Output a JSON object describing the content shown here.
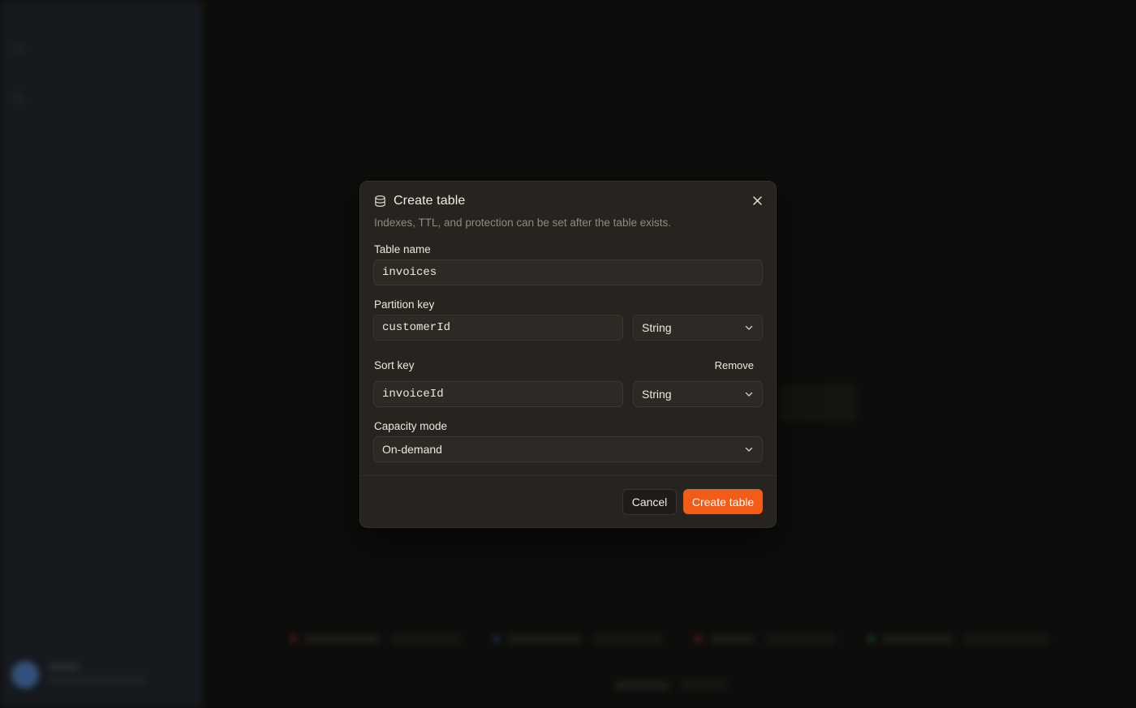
{
  "modal": {
    "title": "Create table",
    "description": "Indexes, TTL, and protection can be set after the table exists.",
    "icon": "database-icon",
    "table_name": {
      "label": "Table name",
      "value": "invoices"
    },
    "partition_key": {
      "label": "Partition key",
      "value": "customerId",
      "type": "String"
    },
    "sort_key": {
      "label": "Sort key",
      "remove_label": "Remove",
      "value": "invoiceId",
      "type": "String"
    },
    "capacity_mode": {
      "label": "Capacity mode",
      "value": "On-demand"
    },
    "actions": {
      "cancel": "Cancel",
      "create": "Create table"
    }
  },
  "colors": {
    "accent": "#f25c17",
    "modal_bg": "#27241f",
    "sidebar_bg": "#1f242b"
  }
}
